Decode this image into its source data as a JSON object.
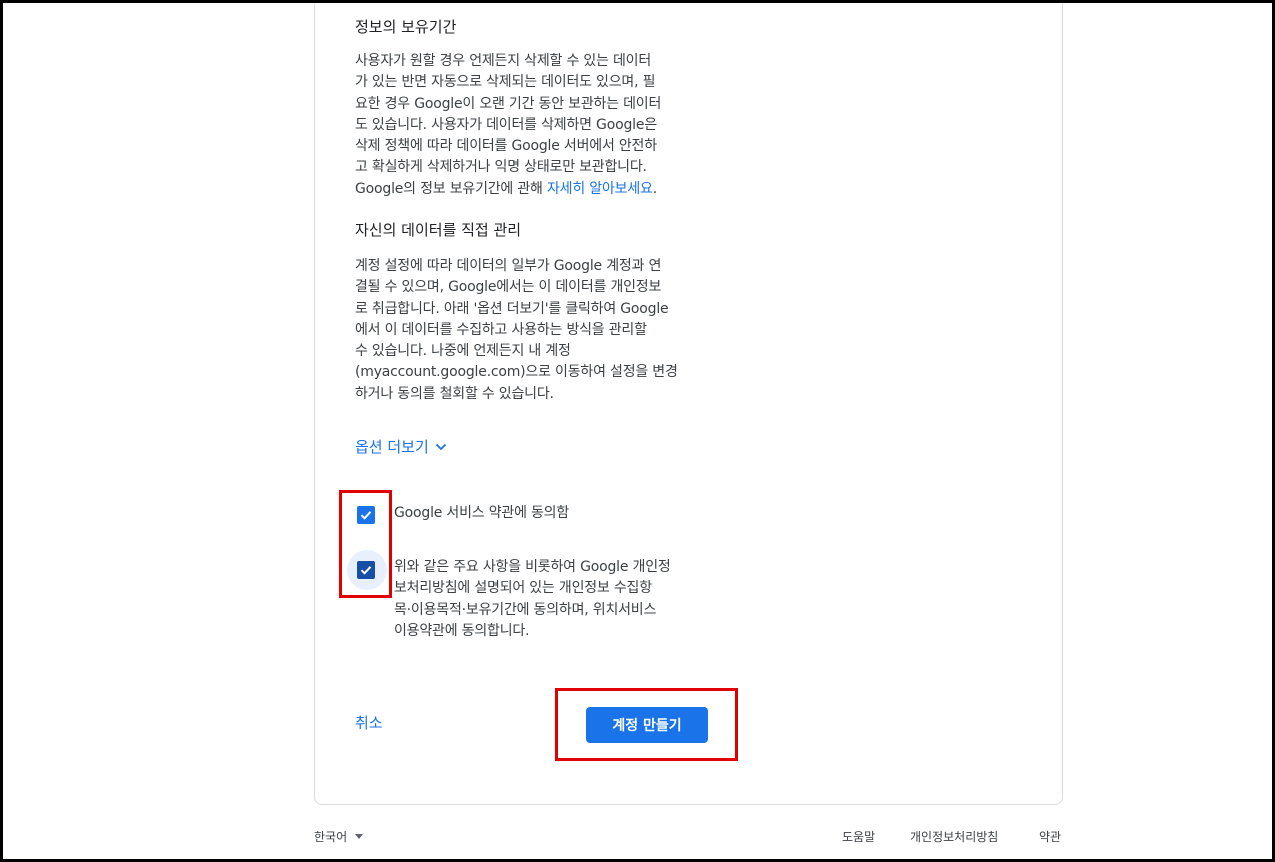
{
  "sections": {
    "retention": {
      "title": "정보의 보유기간",
      "lines": [
        "사용자가 원할 경우 언제든지 삭제할 수 있는 데이터",
        "가 있는 반면 자동으로 삭제되는 데이터도 있으며, 필",
        "요한 경우 Google이 오랜 기간 동안 보관하는 데이터",
        "도 있습니다. 사용자가 데이터를 삭제하면 Google은",
        "삭제 정책에 따라 데이터를 Google 서버에서 안전하",
        "고 확실하게 삭제하거나 익명 상태로만 보관합니다."
      ],
      "last_line_prefix": "Google의 정보 보유기간에 관해 ",
      "learn_more_link": "자세히 알아보세요",
      "last_line_suffix": "."
    },
    "manage": {
      "title": "자신의 데이터를 직접 관리",
      "lines": [
        "계정 설정에 따라 데이터의 일부가 Google 계정과 연",
        "결될 수 있으며, Google에서는 이 데이터를 개인정보",
        "로 취급합니다. 아래 '옵션 더보기'를 클릭하여 Google",
        "에서 이 데이터를 수집하고 사용하는 방식을 관리할",
        "수 있습니다. 나중에 언제든지 내 계정",
        "(myaccount.google.com)으로 이동하여 설정을 변경",
        "하거나 동의를 철회할 수 있습니다."
      ]
    }
  },
  "more_options": "옵션 더보기",
  "consents": {
    "terms": {
      "label": "Google 서비스 약관에 동의함",
      "checked": true
    },
    "privacy": {
      "lines": [
        "위와 같은 주요 사항을 비롯하여 Google 개인정",
        "보처리방침에 설명되어 있는 개인정보 수집항",
        "목·이용목적·보유기간에 동의하며, 위치서비스",
        "이용약관에 동의합니다."
      ],
      "checked": true
    }
  },
  "actions": {
    "cancel": "취소",
    "create": "계정 만들기"
  },
  "footer": {
    "language": "한국어",
    "help": "도움말",
    "privacy": "개인정보처리방침",
    "terms": "약관"
  },
  "colors": {
    "accent": "#1a73e8",
    "highlight": "#e00000",
    "checked_dark": "#174ea6"
  }
}
